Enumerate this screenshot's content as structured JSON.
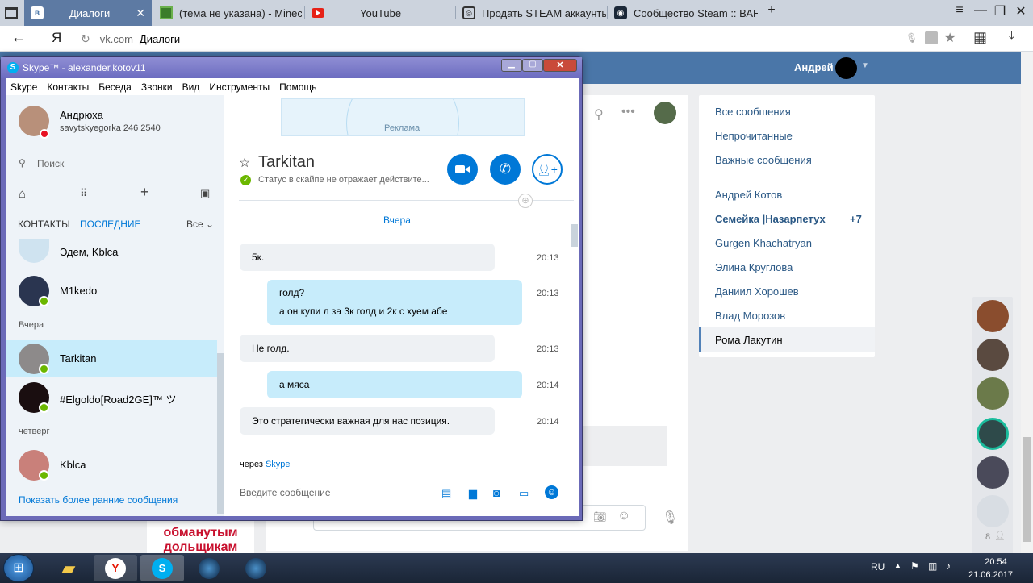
{
  "browser": {
    "tabs": [
      {
        "label": "Диалоги"
      },
      {
        "label": "(тема не указана) - Minecra"
      },
      {
        "label": "YouTube"
      },
      {
        "label": "Продать STEAM аккаунты"
      },
      {
        "label": "Сообщество Steam :: ВАН"
      }
    ],
    "url_host": "vk.com",
    "url_title": "Диалоги",
    "yandex_letter": "Я"
  },
  "vk": {
    "user_name": "Андрей",
    "menu": [
      {
        "label": "Все сообщения"
      },
      {
        "label": "Непрочитанные"
      },
      {
        "label": "Важные сообщения"
      }
    ],
    "dialogs": [
      {
        "label": "Андрей Котов"
      },
      {
        "label": "Семейка |Назарпетух",
        "count": "+7"
      },
      {
        "label": "Gurgen Khachatryan"
      },
      {
        "label": "Элина Круглова"
      },
      {
        "label": "Даниил Хорошев"
      },
      {
        "label": "Влад Морозов"
      },
      {
        "label": "Рома Лакутин"
      }
    ],
    "online_count": "8",
    "ad_text": "обманутым дольщикам"
  },
  "skype": {
    "title": "Skype™ - alexander.kotov11",
    "menu": [
      "Skype",
      "Контакты",
      "Беседа",
      "Звонки",
      "Вид",
      "Инструменты",
      "Помощь"
    ],
    "profile": {
      "name": "Андрюха",
      "status": "savytskyegorka 246 2540"
    },
    "search_placeholder": "Поиск",
    "tabs": {
      "contacts": "КОНТАКТЫ",
      "recent": "ПОСЛЕДНИЕ",
      "all": "Все"
    },
    "contacts": [
      {
        "name": "Эдем, Kblca"
      },
      {
        "name": "M1kedo"
      },
      {
        "section": "Вчера"
      },
      {
        "name": "Tarkitan"
      },
      {
        "name": "#Elgoldo[Road2GE]™ ツ"
      },
      {
        "section": "четверг"
      },
      {
        "name": "Kblca"
      }
    ],
    "show_earlier": "Показать более ранние сообщения",
    "ad_label": "Реклама",
    "chat": {
      "name": "Tarkitan",
      "status": "Статус в скайпе не отражает действите...",
      "day": "Вчера",
      "messages": [
        {
          "lines": [
            "5к."
          ],
          "time": "20:13",
          "side": "left"
        },
        {
          "lines": [
            "голд?",
            "а он купи л за 3к голд и 2к с хуем абе"
          ],
          "time": "20:13",
          "side": "right"
        },
        {
          "lines": [
            "Не голд."
          ],
          "time": "20:13",
          "side": "left"
        },
        {
          "lines": [
            "а мяса"
          ],
          "time": "20:14",
          "side": "right"
        },
        {
          "lines": [
            "Это стратегически важная для нас позиция."
          ],
          "time": "20:14",
          "side": "left"
        }
      ],
      "via_prefix": "через",
      "via_link": "Skype",
      "input_placeholder": "Введите сообщение"
    }
  },
  "taskbar": {
    "lang": "RU",
    "time": "20:54",
    "date": "21.06.2017"
  },
  "colors": {
    "skype_blue": "#0078d7",
    "vk_blue": "#4a76a8",
    "online_green": "#6bb700"
  }
}
